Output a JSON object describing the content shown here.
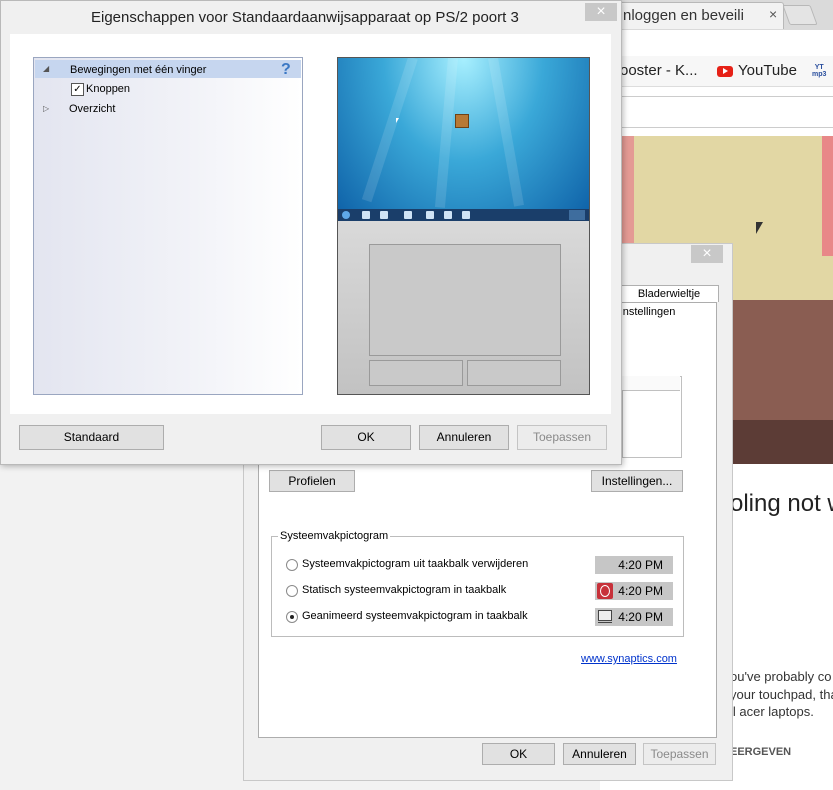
{
  "browser": {
    "tab_title": "nloggen en beveili",
    "tab_close": "×",
    "bookmarks": {
      "item1": "ooster - K...",
      "youtube": "YouTube",
      "ytmp3_line1": "YT",
      "ytmp3_line2": "mp3"
    },
    "article": {
      "heading": "oling not w",
      "para_line1": "ou've probably co",
      "para_line2": "your touchpad, tha",
      "para_line3": "ll acer laptops.",
      "caps": "EERGEVEN"
    }
  },
  "back_dialog": {
    "close": "×",
    "tab_label": "Bladerwieltje",
    "tab_text": "aatinstellingen",
    "profiles_button": "Profielen",
    "settings_button": "Instellingen...",
    "group_title": "Systeemvakpictogram",
    "options": [
      {
        "label": "Systeemvakpictogram uit taakbalk verwijderen",
        "time": "4:20 PM",
        "selected": false
      },
      {
        "label": "Statisch systeemvakpictogram in taakbalk",
        "time": "4:20 PM",
        "selected": false
      },
      {
        "label": "Geanimeerd systeemvakpictogram in taakbalk",
        "time": "4:20 PM",
        "selected": true
      }
    ],
    "link": "www.synaptics.com",
    "ok": "OK",
    "cancel": "Annuleren",
    "apply": "Toepassen"
  },
  "front_dialog": {
    "title": "Eigenschappen voor Standaardaanwijsapparaat op PS/2 poort 3",
    "close": "×",
    "tree": {
      "item1": "Bewegingen met één vinger",
      "item1_arrow": "◢",
      "help": "?",
      "item2": "Knoppen",
      "item2_checked": "✓",
      "item3": "Overzicht",
      "item3_arrow": "▷"
    },
    "default_button": "Standaard",
    "ok": "OK",
    "cancel": "Annuleren",
    "apply": "Toepassen"
  },
  "colors": {
    "selection": "#c6d6ef",
    "link": "#0033cc",
    "youtube_red": "#e62117"
  }
}
